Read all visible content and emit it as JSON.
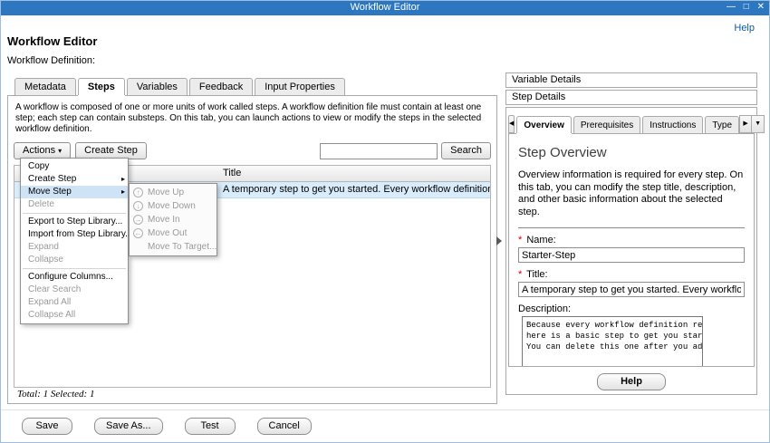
{
  "colors": {
    "titlebar": "#2c77c0",
    "row_selection": "#d9ecfb",
    "menu_highlight": "#cfe3f7",
    "link": "#0b5cad",
    "required_marker": "#cc0000"
  },
  "window": {
    "title": "Workflow Editor",
    "minimize": "—",
    "maximize": "□",
    "close": "✕"
  },
  "header": {
    "help": "Help",
    "title": "Workflow Editor",
    "subtitle": "Workflow Definition:"
  },
  "left_panel": {
    "tabs": [
      {
        "label": "Metadata"
      },
      {
        "label": "Steps"
      },
      {
        "label": "Variables"
      },
      {
        "label": "Feedback"
      },
      {
        "label": "Input Properties"
      }
    ],
    "selected_tab": "Steps",
    "description": "A workflow is composed of one or more units of work called steps. A workflow definition file must contain at least one step; each step can contain substeps. On this tab, you can launch actions to view or modify the steps in the selected workflow definition.",
    "toolbar": {
      "actions": "Actions",
      "actions_caret": "▾",
      "create_step": "Create Step",
      "search_value": "",
      "search": "Search"
    },
    "table": {
      "columns": [
        "Title"
      ],
      "rows": [
        {
          "title": "A temporary step to get you started. Every workflow definition requires at least one step.",
          "selected": true
        }
      ]
    },
    "status": "Total: 1 Selected: 1"
  },
  "actions_menu": {
    "submenu_arrow": "▸",
    "items": [
      {
        "label": "Copy",
        "enabled": true
      },
      {
        "label": "Create Step",
        "enabled": true,
        "submenu": true
      },
      {
        "label": "Move Step",
        "enabled": true,
        "submenu": true,
        "highlighted": true
      },
      {
        "label": "Delete",
        "enabled": false
      },
      {
        "label": "Export to Step Library...",
        "enabled": true
      },
      {
        "label": "Import from Step Library...",
        "enabled": true
      },
      {
        "label": "Expand",
        "enabled": false
      },
      {
        "label": "Collapse",
        "enabled": false
      },
      {
        "label": "Configure Columns...",
        "enabled": true
      },
      {
        "label": "Clear Search",
        "enabled": false
      },
      {
        "label": "Expand All",
        "enabled": false
      },
      {
        "label": "Collapse All",
        "enabled": false
      }
    ]
  },
  "move_step_submenu": {
    "items": [
      {
        "label": "Move Up",
        "icon": "circle-arrow-up-icon",
        "glyph": "↑",
        "enabled": false
      },
      {
        "label": "Move Down",
        "icon": "circle-arrow-down-icon",
        "glyph": "↓",
        "enabled": false
      },
      {
        "label": "Move In",
        "icon": "circle-arrow-right-icon",
        "glyph": "→",
        "enabled": false
      },
      {
        "label": "Move Out",
        "icon": "circle-arrow-left-icon",
        "glyph": "←",
        "enabled": false
      },
      {
        "label": "Move To Target...",
        "icon": "none",
        "glyph": "",
        "enabled": false
      }
    ]
  },
  "right_panel": {
    "variable_details": "Variable Details",
    "step_details": "Step Details",
    "tab_scroll_left": "◀",
    "tab_scroll_right": "▶",
    "tab_menu": "▼",
    "tabs": [
      {
        "label": "Overview"
      },
      {
        "label": "Prerequisites"
      },
      {
        "label": "Instructions"
      },
      {
        "label": "Type"
      }
    ],
    "selected_tab": "Overview",
    "overview": {
      "heading": "Step Overview",
      "description": "Overview information is required for every step. On this tab, you can modify the step title, description, and other basic information about the selected step.",
      "required_marker": "*",
      "name_label": "Name:",
      "name_value": "Starter-Step",
      "title_label": "Title:",
      "title_value": "A temporary step to get you started. Every workflow definition",
      "description_label": "Description:",
      "description_value": "Because every workflow definition req\nhere is a basic step to get you start\nYou can delete this one after you add",
      "help": "Help"
    }
  },
  "footer": {
    "buttons": [
      {
        "label": "Save"
      },
      {
        "label": "Save As..."
      },
      {
        "label": "Test"
      },
      {
        "label": "Cancel"
      }
    ]
  }
}
